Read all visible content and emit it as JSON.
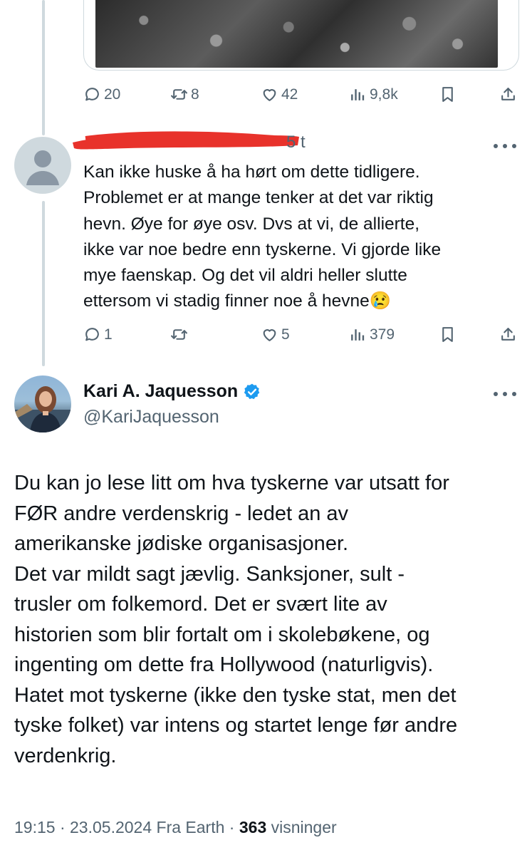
{
  "top_tweet": {
    "stats": {
      "replies": "20",
      "reposts": "8",
      "likes": "42",
      "views": "9,8k"
    }
  },
  "reply": {
    "time": "5 t",
    "lines": [
      "Kan ikke huske å ha hørt om dette tidligere.",
      "Problemet er at mange tenker at det var riktig",
      "hevn. Øye for øye osv. Dvs at vi, de allierte,",
      "ikke var noe bedre enn tyskerne. Vi gjorde like",
      "mye faenskap. Og det vil aldri heller slutte",
      "ettersom vi stadig finner noe å hevne😢"
    ],
    "stats": {
      "replies": "1",
      "reposts": "",
      "likes": "5",
      "views": "379"
    }
  },
  "main_tweet": {
    "author_name": "Kari A. Jaquesson",
    "handle": "@KariJaquesson",
    "lines": [
      "Du kan jo lese litt om hva tyskerne var utsatt for",
      "FØR andre verdenskrig - ledet an av",
      "amerikanske jødiske organisasjoner.",
      "Det var mildt sagt jævlig. Sanksjoner, sult -",
      "trusler om folkemord. Det er svært lite av",
      "historien som blir fortalt om i skolebøkene, og",
      "ingenting om dette fra Hollywood (naturligvis).",
      "Hatet mot tyskerne (ikke den tyske stat, men det",
      "tyske folket) var intens og startet lenge før andre",
      "verdenkrig."
    ],
    "footer": {
      "time": "19:15",
      "date": "23.05.2024",
      "source": "Fra Earth",
      "views_count": "363",
      "views_label": "visninger"
    }
  },
  "icons": {
    "reply": "speech-bubble-icon",
    "repost": "repost-arrows-icon",
    "like": "heart-icon",
    "views": "bar-chart-icon",
    "bookmark": "bookmark-icon",
    "share": "share-upload-icon",
    "more": "more-dots-icon",
    "verified": "verified-badge-icon"
  },
  "colors": {
    "text_primary": "#0f1419",
    "text_secondary": "#536471",
    "verified_blue": "#1d9bf0",
    "redaction_red": "#e8322b",
    "thread_line": "#cfd9de"
  }
}
